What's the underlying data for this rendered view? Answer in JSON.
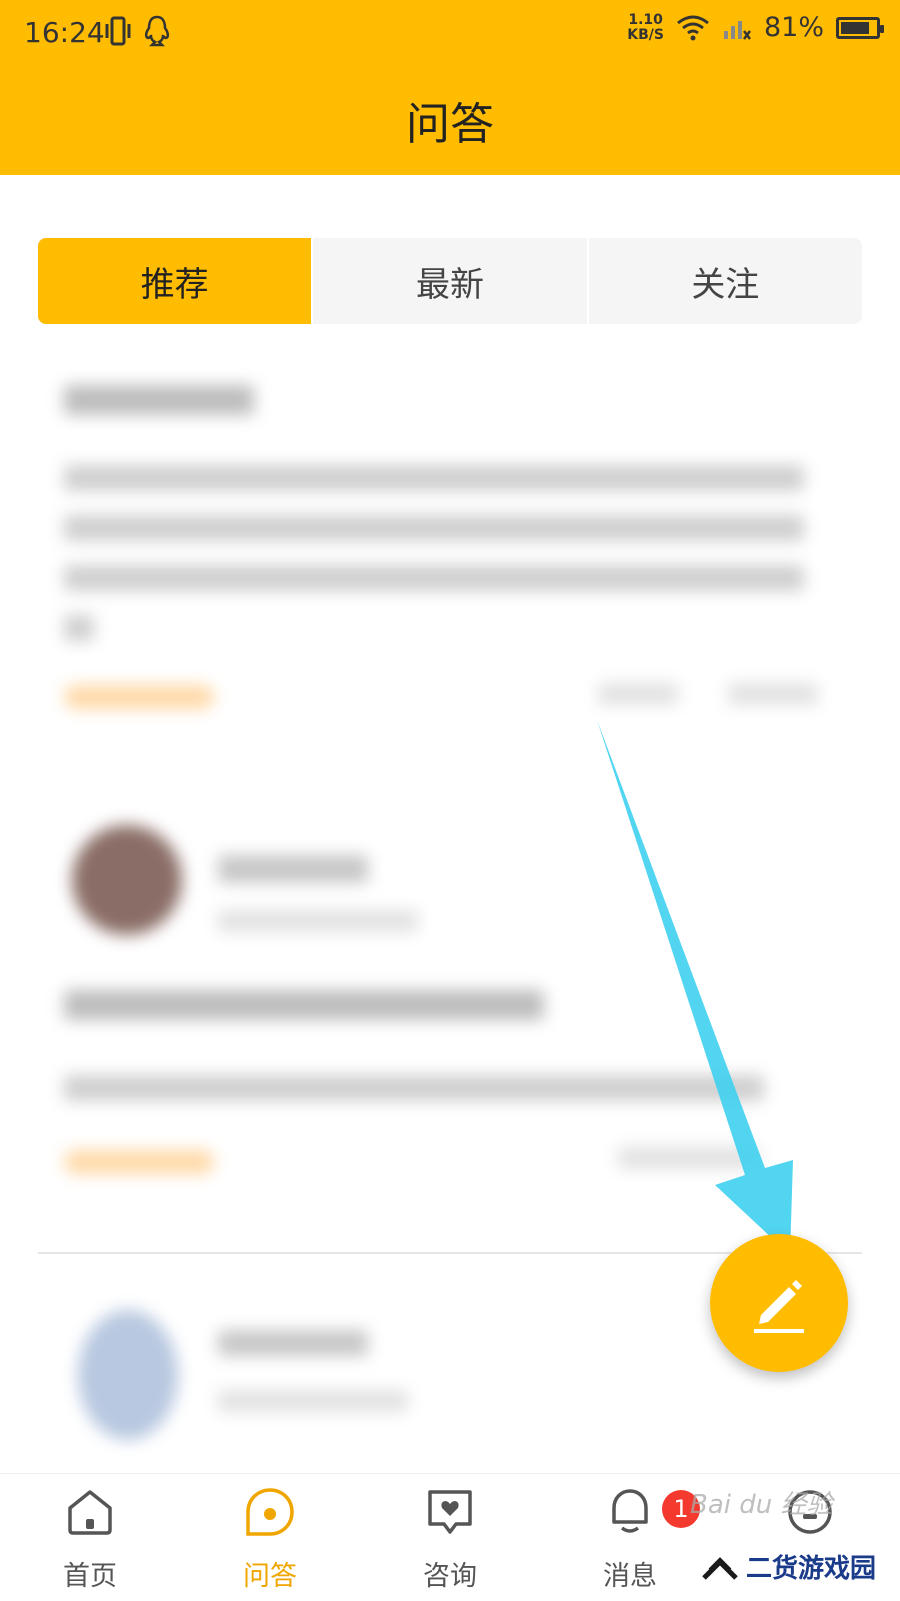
{
  "status_bar": {
    "time": "16:24",
    "net_speed_value": "1.10",
    "net_speed_unit": "KB/S",
    "battery_percent": "81%",
    "battery_level": 0.81
  },
  "header": {
    "title": "问答"
  },
  "tabs": [
    {
      "label": "推荐",
      "active": true
    },
    {
      "label": "最新",
      "active": false
    },
    {
      "label": "关注",
      "active": false
    }
  ],
  "bottom_nav": [
    {
      "label": "首页",
      "icon": "home-icon"
    },
    {
      "label": "问答",
      "icon": "qa-icon",
      "active": true
    },
    {
      "label": "咨询",
      "icon": "consult-icon"
    },
    {
      "label": "消息",
      "icon": "bell-icon",
      "badge": "1"
    },
    {
      "label": "",
      "icon": "profile-icon"
    }
  ],
  "watermark": {
    "text": "Bai du 经验",
    "brand": "二货游戏园"
  },
  "colors": {
    "accent": "#FFBC00",
    "arrow": "#3FD0F0",
    "badge": "#F43A2F"
  },
  "fab_icon": "pencil-icon"
}
